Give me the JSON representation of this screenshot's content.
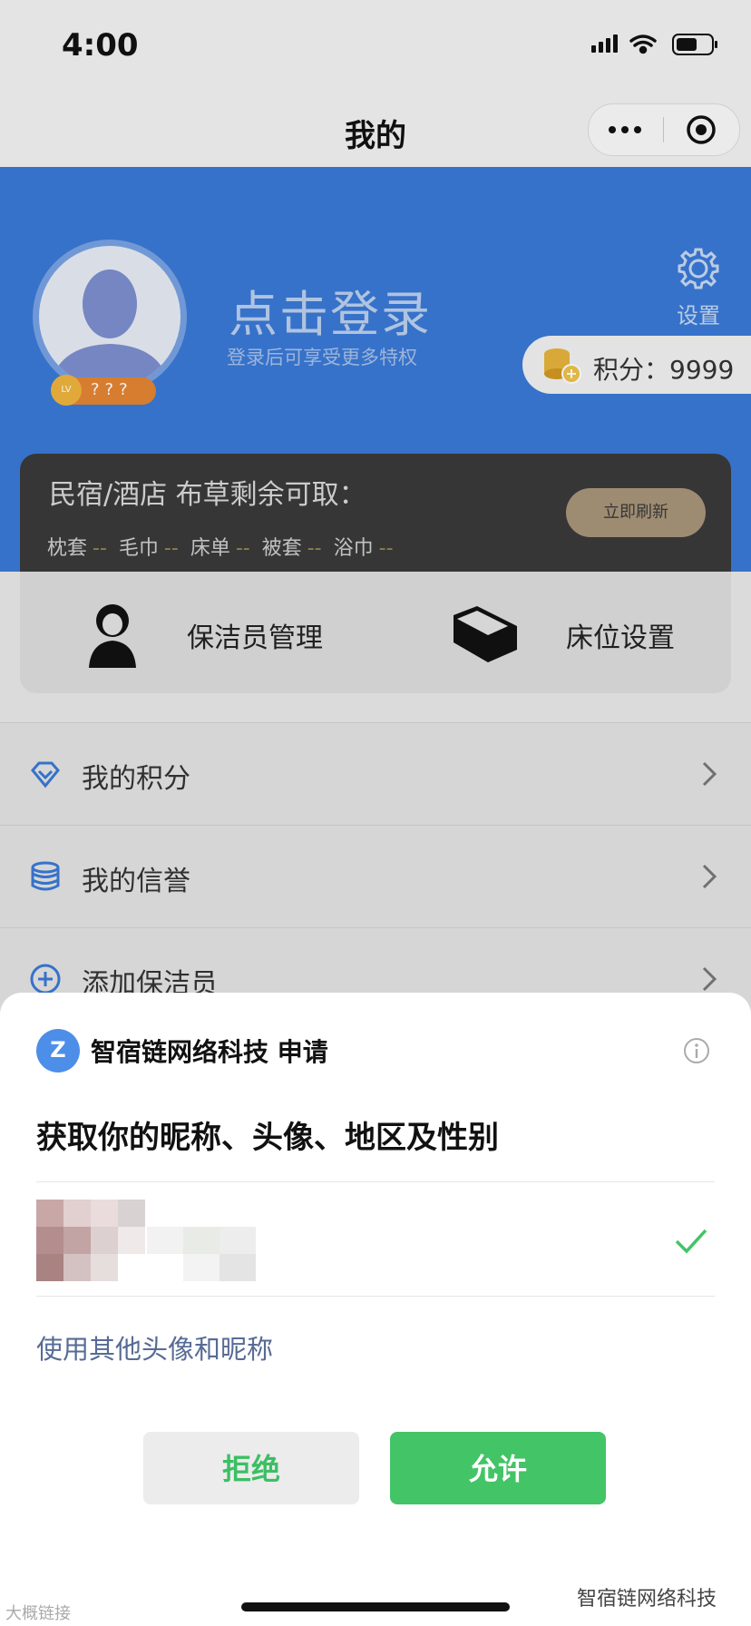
{
  "status_bar": {
    "time": "4:00"
  },
  "nav": {
    "title": "我的"
  },
  "header": {
    "login_title": "点击登录",
    "login_subtitle": "登录后可享受更多特权",
    "level_text": "???",
    "settings_label": "设置",
    "points_text": "积分：9999"
  },
  "linen_card": {
    "title": "民宿/酒店 布草剩余可取：",
    "items": [
      {
        "name": "枕套",
        "value": "--"
      },
      {
        "name": "毛巾",
        "value": "--"
      },
      {
        "name": "床单",
        "value": "--"
      },
      {
        "name": "被套",
        "value": "--"
      },
      {
        "name": "浴巾",
        "value": "--"
      }
    ],
    "refresh_label": "立即刷新"
  },
  "quick_actions": [
    {
      "label": "保洁员管理",
      "icon": "cleaner-icon"
    },
    {
      "label": "床位设置",
      "icon": "bed-icon"
    }
  ],
  "menu": [
    {
      "label": "我的积分",
      "icon": "diamond-icon"
    },
    {
      "label": "我的信誉",
      "icon": "coins-stack-icon"
    },
    {
      "label": "添加保洁员",
      "icon": "plus-circle-icon"
    }
  ],
  "auth_sheet": {
    "app_name": "智宿链网络科技",
    "request_word": "申请",
    "permission_title": "获取你的昵称、头像、地区及性别",
    "use_other_link": "使用其他头像和昵称",
    "deny_label": "拒绝",
    "allow_label": "允许"
  },
  "watermarks": {
    "left": "大概链接",
    "right": "智宿链网络科技"
  },
  "colors": {
    "header_blue": "#3a7ad6",
    "allow_green": "#43c466",
    "link_blue": "#576b95"
  }
}
